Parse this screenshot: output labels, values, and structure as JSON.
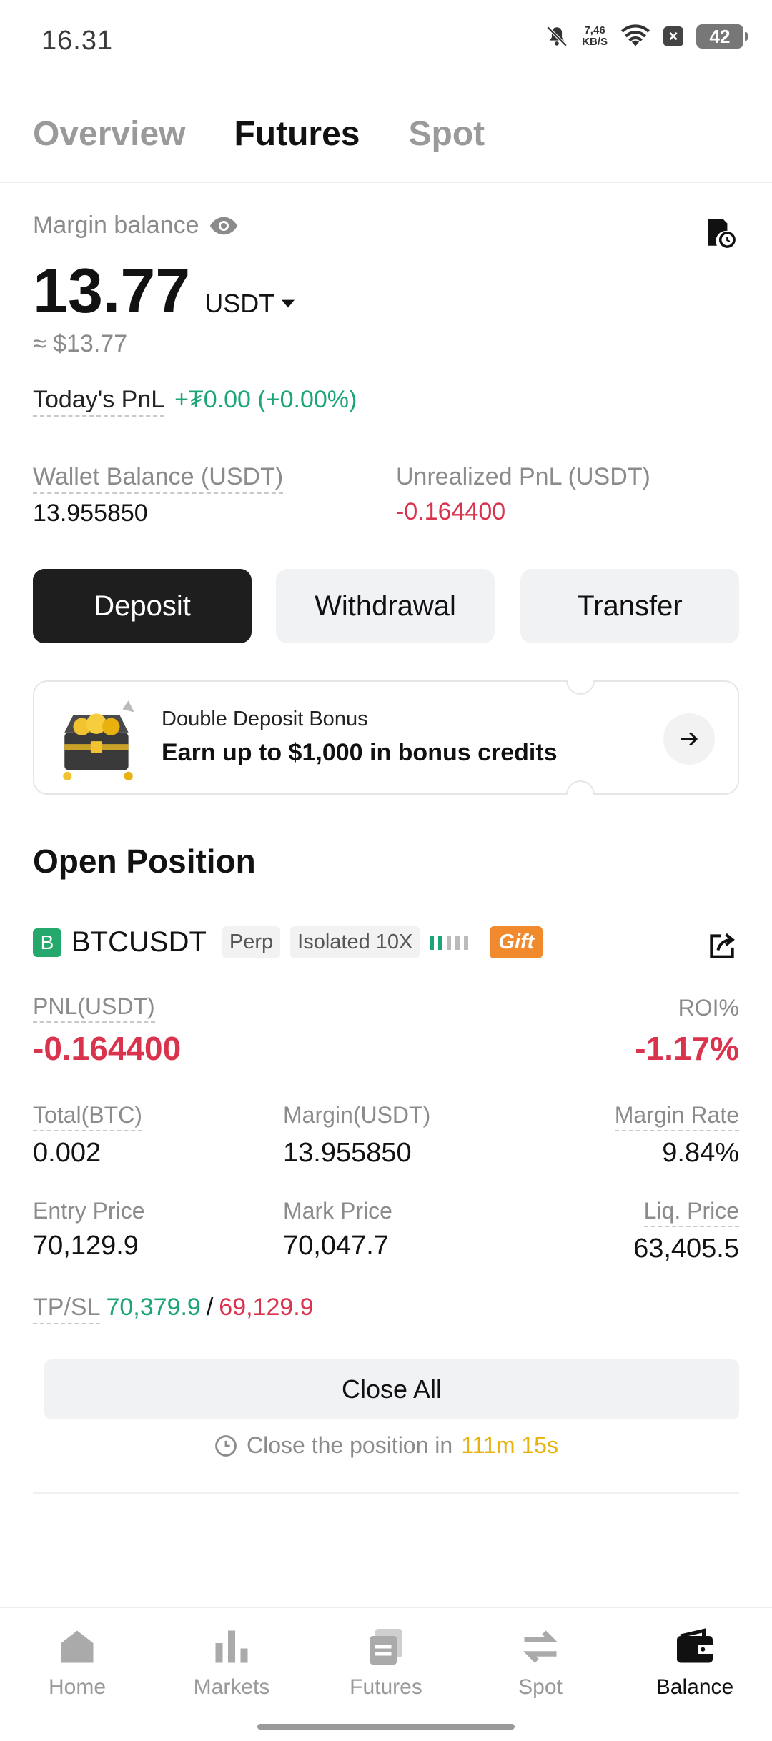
{
  "status": {
    "time": "16.31",
    "net_speed_top": "7,46",
    "net_speed_bottom": "KB/S",
    "battery": "42"
  },
  "tabs": [
    {
      "label": "Overview"
    },
    {
      "label": "Futures"
    },
    {
      "label": "Spot"
    }
  ],
  "balance": {
    "label": "Margin balance",
    "amount": "13.77",
    "currency": "USDT",
    "approx": "≈ $13.77",
    "pnl_label": "Today's PnL",
    "pnl_value": "+₮0.00 (+0.00%)",
    "wallet_label": "Wallet Balance (USDT)",
    "wallet_value": "13.955850",
    "unrealized_label": "Unrealized PnL (USDT)",
    "unrealized_value": "-0.164400"
  },
  "actions": {
    "deposit": "Deposit",
    "withdrawal": "Withdrawal",
    "transfer": "Transfer"
  },
  "banner": {
    "title": "Double Deposit Bonus",
    "subtitle": "Earn up to $1,000 in bonus credits"
  },
  "position": {
    "section_title": "Open Position",
    "badge": "B",
    "symbol": "BTCUSDT",
    "type_pill": "Perp",
    "mode_pill": "Isolated 10X",
    "gift": "Gift",
    "pnl_label": "PNL(USDT)",
    "pnl_value": "-0.164400",
    "roi_label": "ROI%",
    "roi_value": "-1.17%",
    "total_label": "Total(BTC)",
    "total_value": "0.002",
    "margin_label": "Margin(USDT)",
    "margin_value": "13.955850",
    "margin_rate_label": "Margin Rate",
    "margin_rate_value": "9.84%",
    "entry_label": "Entry Price",
    "entry_value": "70,129.9",
    "mark_label": "Mark Price",
    "mark_value": "70,047.7",
    "liq_label": "Liq. Price",
    "liq_value": "63,405.5",
    "tpsl_label": "TP/SL",
    "tp_value": "70,379.9",
    "tpsl_separator": "/",
    "sl_value": "69,129.9",
    "close_all": "Close All",
    "countdown_text": "Close the position in",
    "countdown_value": "111m 15s"
  },
  "nav": [
    {
      "label": "Home",
      "icon": "home-icon"
    },
    {
      "label": "Markets",
      "icon": "markets-icon"
    },
    {
      "label": "Futures",
      "icon": "futures-icon"
    },
    {
      "label": "Spot",
      "icon": "spot-icon"
    },
    {
      "label": "Balance",
      "icon": "wallet-icon"
    }
  ],
  "colors": {
    "green": "#1da57a",
    "red": "#d9334d",
    "countdown": "#e8b10d",
    "gift": "#f08a2c",
    "badge": "#25a86b"
  }
}
